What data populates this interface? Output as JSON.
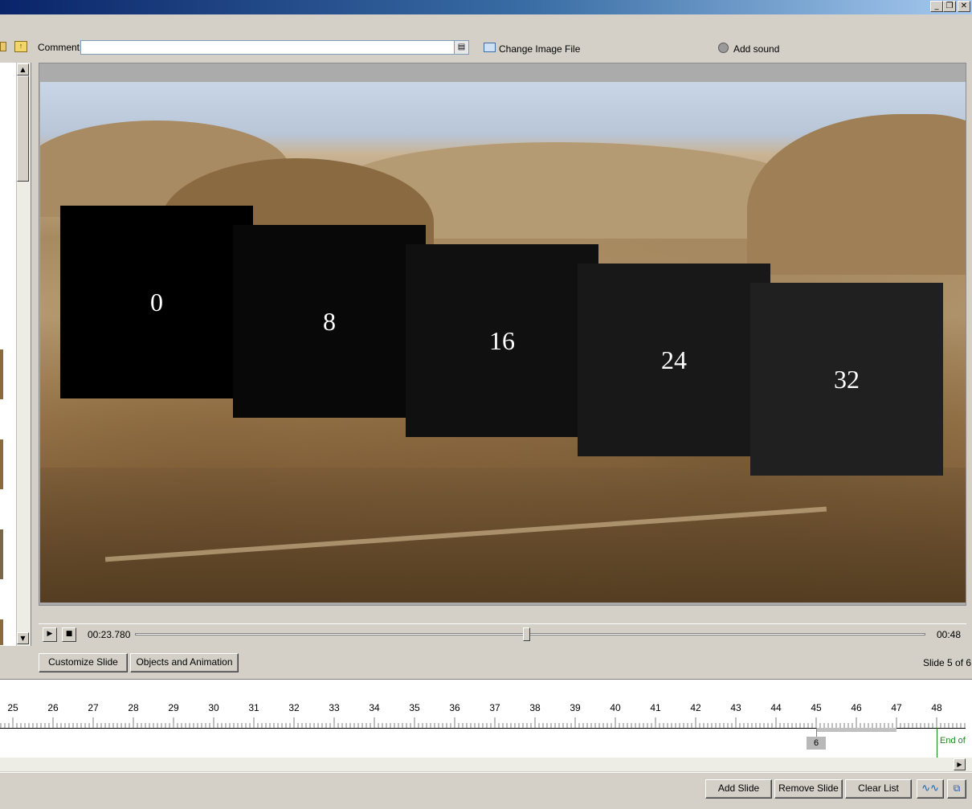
{
  "toolbar": {
    "comment_label": "Comment",
    "comment_value": "",
    "change_image_label": "Change Image File",
    "add_sound_label": "Add sound"
  },
  "preview": {
    "boxes": [
      {
        "label": "0",
        "color": "#000000"
      },
      {
        "label": "8",
        "color": "#080808"
      },
      {
        "label": "16",
        "color": "#101010"
      },
      {
        "label": "24",
        "color": "#181818"
      },
      {
        "label": "32",
        "color": "#202020"
      }
    ]
  },
  "playback": {
    "current_time": "00:23.780",
    "total_time": "00:48",
    "progress_fraction": 0.495
  },
  "buttons": {
    "customize_slide": "Customize Slide",
    "objects_animation": "Objects and Animation",
    "add_slide": "Add Slide",
    "remove_slide": "Remove Slide",
    "clear_list": "Clear List"
  },
  "slide_counter": "Slide 5 of 6",
  "timeline": {
    "ticks": [
      "25",
      "26",
      "27",
      "28",
      "29",
      "30",
      "31",
      "32",
      "33",
      "34",
      "35",
      "36",
      "37",
      "38",
      "39",
      "40",
      "41",
      "42",
      "43",
      "44",
      "45",
      "46",
      "47",
      "48"
    ],
    "slide_marker": "6",
    "end_label": "End of"
  }
}
